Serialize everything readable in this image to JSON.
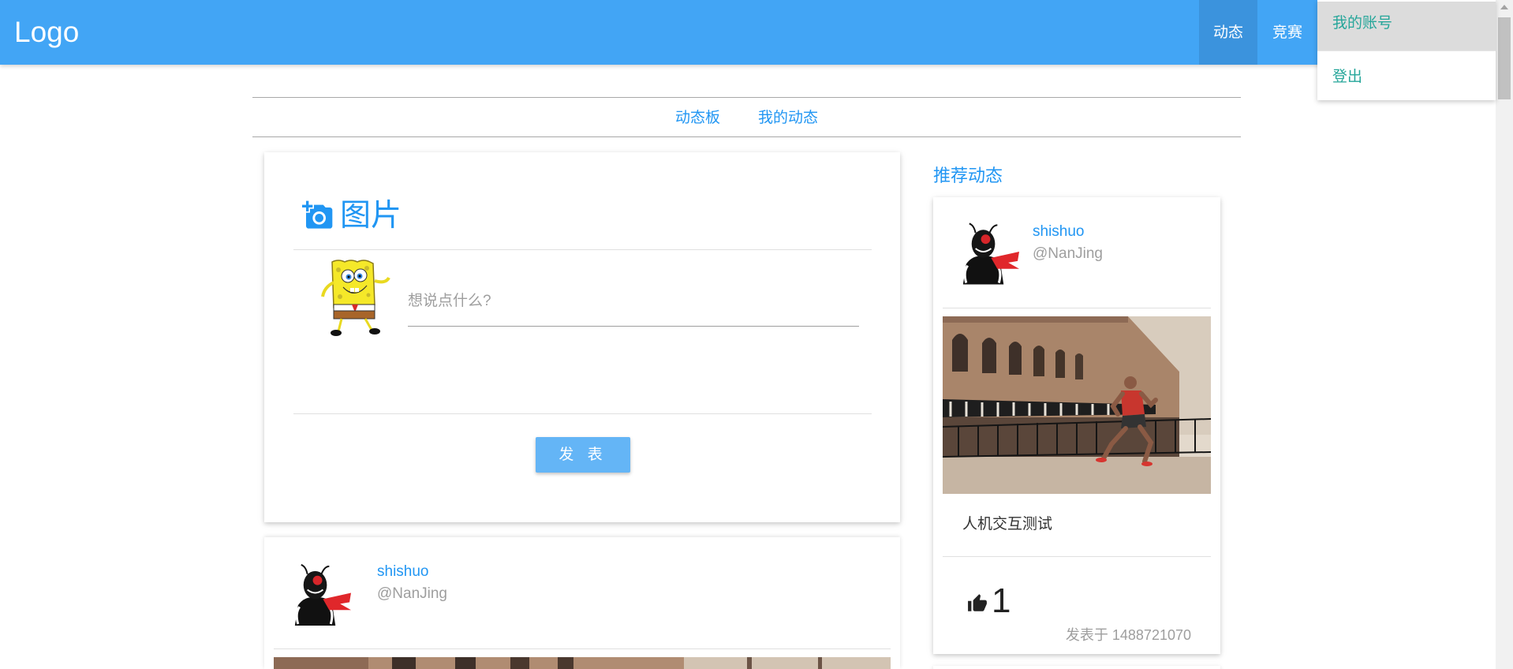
{
  "navbar": {
    "logo": "Logo",
    "items": [
      {
        "label": "动态",
        "active": true
      },
      {
        "label": "竞赛",
        "active": false
      }
    ]
  },
  "account_menu": {
    "items": [
      {
        "label": "我的账号",
        "highlighted": true
      },
      {
        "label": "登出",
        "highlighted": false
      }
    ]
  },
  "tabs": [
    {
      "label": "动态板"
    },
    {
      "label": "我的动态"
    }
  ],
  "composer": {
    "title": "图片",
    "title_icon": "add-photo-icon",
    "avatar": "spongebob-avatar",
    "placeholder": "想说点什么?",
    "value": "",
    "submit_label": "发 表"
  },
  "feed": {
    "posts": [
      {
        "username": "shishuo",
        "location": "@NanJing",
        "avatar": "rider-avatar"
      }
    ]
  },
  "recommended": {
    "heading": "推荐动态",
    "posts": [
      {
        "username": "shishuo",
        "location": "@NanJing",
        "avatar": "rider-avatar",
        "text": "人机交互测试",
        "like_icon": "thumb-up-icon",
        "likes": "1",
        "posted": "发表于 1488721070"
      }
    ]
  },
  "colors": {
    "navbar": "#42a5f5",
    "nav_active": "#3b93dd",
    "accent": "#2196f3",
    "button": "#64b5f6",
    "menu_text": "#26a69a",
    "muted": "#9e9e9e"
  }
}
